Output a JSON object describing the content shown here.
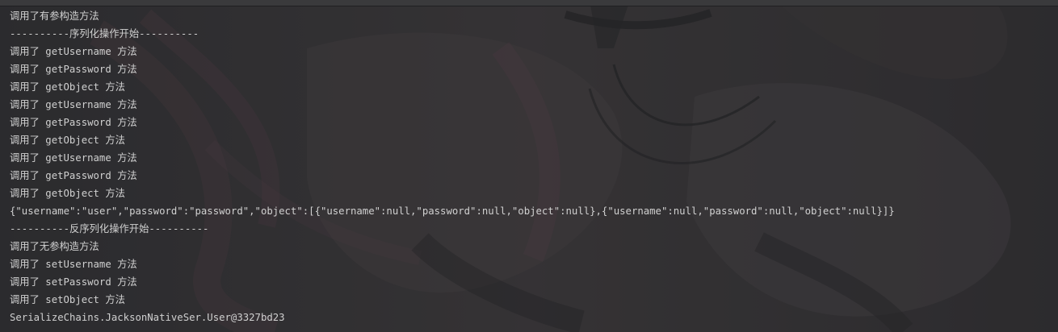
{
  "console": {
    "lines": [
      "调用了有参构造方法",
      "----------序列化操作开始----------",
      "调用了 getUsername 方法",
      "调用了 getPassword 方法",
      "调用了 getObject 方法",
      "调用了 getUsername 方法",
      "调用了 getPassword 方法",
      "调用了 getObject 方法",
      "调用了 getUsername 方法",
      "调用了 getPassword 方法",
      "调用了 getObject 方法",
      "{\"username\":\"user\",\"password\":\"password\",\"object\":[{\"username\":null,\"password\":null,\"object\":null},{\"username\":null,\"password\":null,\"object\":null}]}",
      "----------反序列化操作开始----------",
      "调用了无参构造方法",
      "调用了 setUsername 方法",
      "调用了 setPassword 方法",
      "调用了 setObject 方法",
      "SerializeChains.JacksonNativeSer.User@3327bd23"
    ]
  },
  "colors": {
    "background": "#2e2e30",
    "text": "#d0d0d0"
  },
  "icons": {
    "background_art": "anime-wallpaper-image"
  }
}
